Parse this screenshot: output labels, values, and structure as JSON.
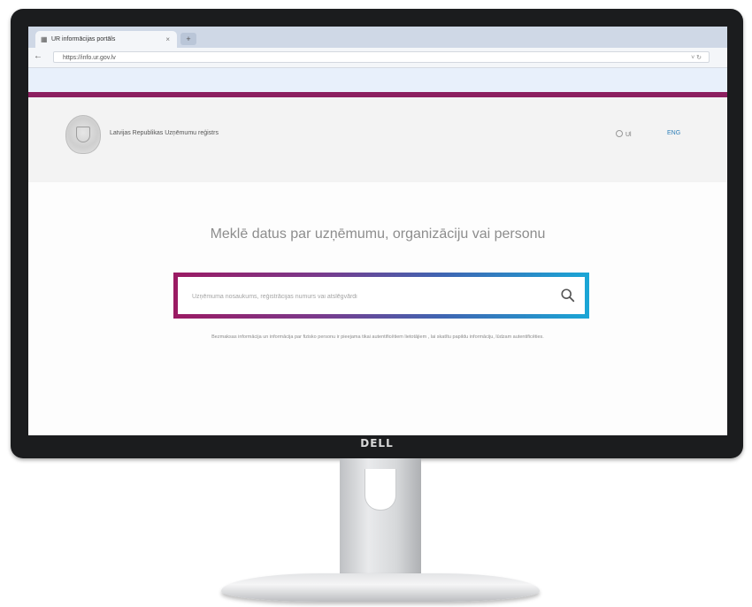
{
  "device": {
    "brand": "DELL"
  },
  "browser": {
    "tab_title": "UR informācijas portāls",
    "tab_close": "×",
    "new_tab": "+",
    "back": "←",
    "url": "https://info.ur.gov.lv",
    "url_icons": "˅ ↻"
  },
  "header": {
    "organization": "Latvijas Republikas Uzņēmumu reģistrs",
    "login_label": "Ul",
    "language": "ENG"
  },
  "main": {
    "headline": "Meklē datus par uzņēmumu, organizāciju vai personu",
    "search_placeholder": "Uzņēmuma nosaukums, reģistrācijas numurs vai atslēgvārdi",
    "notice": "Bezmaksas informācija un informācija par fizisko personu ir pieejama tikai autentificētiem lietotājiem , lai skatītu papildu informāciju, lūdzam autentificēties."
  },
  "colors": {
    "accent_bar": "#8c1f5f",
    "search_gradient_start": "#9b1a63",
    "search_gradient_end": "#1aa6d6",
    "link": "#2e7fb8"
  },
  "icons": [
    "crest-logo-icon",
    "search-icon",
    "user-icon",
    "favicon-icon"
  ]
}
